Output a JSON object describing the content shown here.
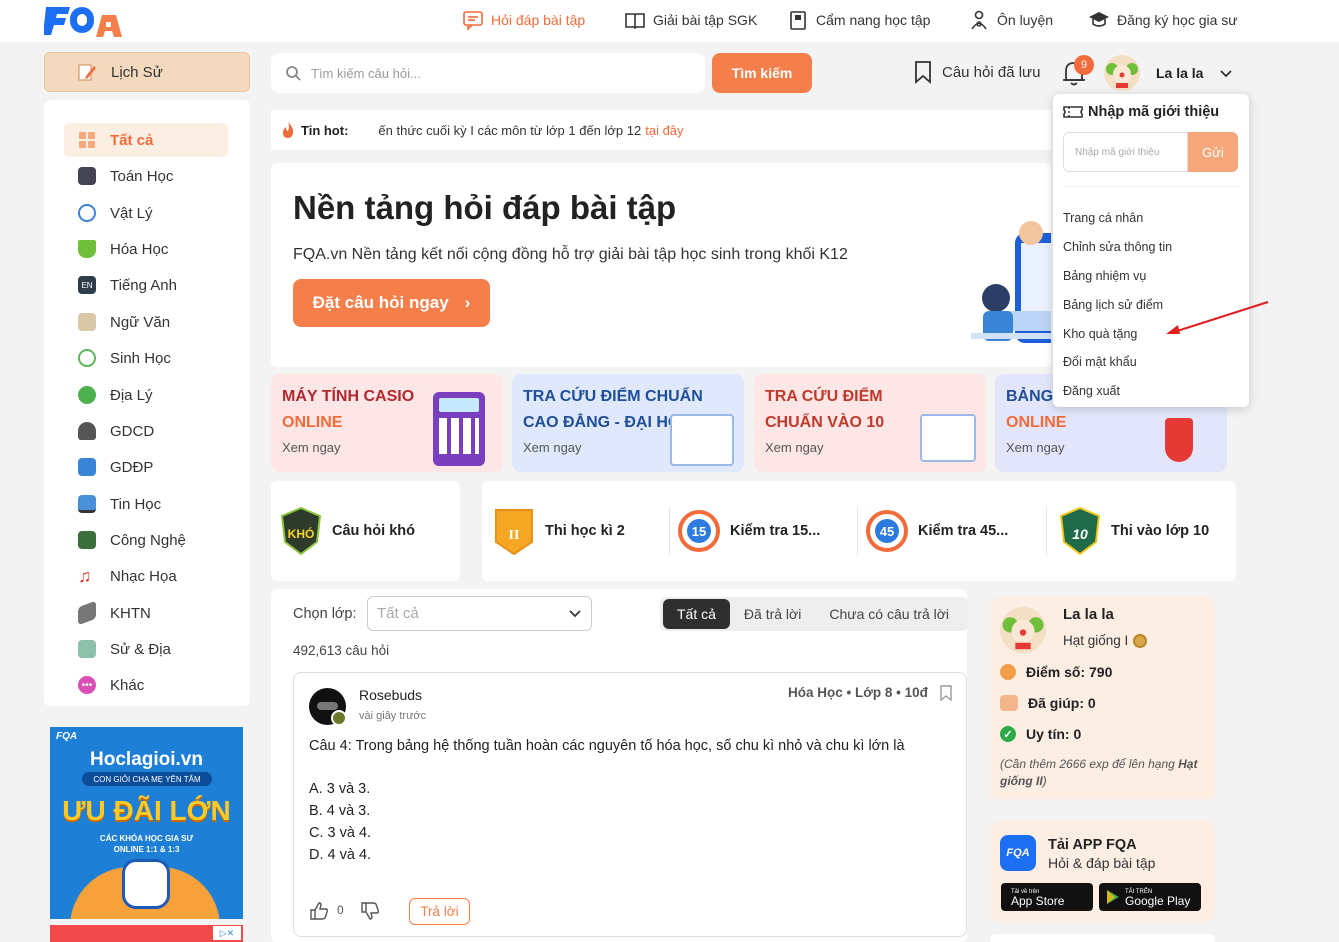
{
  "nav": {
    "items": [
      {
        "label": "Hỏi đáp bài tập",
        "icon": "chat-icon"
      },
      {
        "label": "Giải bài tập SGK",
        "icon": "book-icon"
      },
      {
        "label": "Cẩm nang học tập",
        "icon": "handbook-icon"
      },
      {
        "label": "Ôn luyện",
        "icon": "practice-icon"
      },
      {
        "label": "Đăng ký học gia sư",
        "icon": "graduation-cap-icon"
      }
    ],
    "accent": "#f26b3a"
  },
  "subject_selector": {
    "label": "Lịch Sử"
  },
  "search": {
    "placeholder": "Tìm kiếm câu hỏi...",
    "button": "Tìm kiếm"
  },
  "header": {
    "saved_label": "Câu hỏi đã lưu",
    "notification_count": "9",
    "username": "La la la"
  },
  "sidebar": {
    "items": [
      {
        "label": "Tất cả",
        "icon": "grid-icon",
        "selected": true
      },
      {
        "label": "Toán Học",
        "icon": "calculator-icon"
      },
      {
        "label": "Vật Lý",
        "icon": "atom-icon"
      },
      {
        "label": "Hóa Học",
        "icon": "flask-icon"
      },
      {
        "label": "Tiếng Anh",
        "icon": "english-icon"
      },
      {
        "label": "Ngữ Văn",
        "icon": "open-book-icon"
      },
      {
        "label": "Sinh Học",
        "icon": "dna-icon"
      },
      {
        "label": "Địa Lý",
        "icon": "globe-icon"
      },
      {
        "label": "GDCD",
        "icon": "citizen-icon"
      },
      {
        "label": "GDĐP",
        "icon": "local-icon"
      },
      {
        "label": "Tin Học",
        "icon": "computer-icon"
      },
      {
        "label": "Công Nghệ",
        "icon": "chip-icon"
      },
      {
        "label": "Nhạc Họa",
        "icon": "music-icon"
      },
      {
        "label": "KHTN",
        "icon": "telescope-icon"
      },
      {
        "label": "Sử & Địa",
        "icon": "map-icon"
      },
      {
        "label": "Khác",
        "icon": "more-icon"
      }
    ]
  },
  "ad": {
    "site": "Hoclagioi.vn",
    "tagline": "CON GIỎI CHA MẸ YÊN TÂM",
    "headline": "ƯU ĐÃI LỚN",
    "sub": "CÁC KHÓA HỌC GIA SƯ ONLINE 1:1 & 1:3"
  },
  "hot": {
    "label": "Tin hot:",
    "text": "ến thức cuối kỳ I các môn từ lớp 1 đến lớp 12",
    "link": "tại đây"
  },
  "hero": {
    "title": "Nền tảng hỏi đáp bài tập",
    "subtitle": "FQA.vn Nền tảng kết nối cộng đồng hỗ trợ giải bài tập học sinh trong khối K12",
    "button": "Đặt câu hỏi ngay"
  },
  "cards": [
    {
      "line1": "MÁY TÍNH CASIO",
      "line2": "ONLINE",
      "more": "Xem ngay"
    },
    {
      "line1": "TRA CỨU ĐIỂM CHUẨN",
      "line2": "CAO ĐẲNG - ĐẠI HỌC",
      "more": "Xem ngay"
    },
    {
      "line1": "TRA CỨU ĐIỂM",
      "line2": "CHUẨN VÀO 10",
      "more": "Xem ngay"
    },
    {
      "line1": "BẢNG",
      "line2": "ONLINE",
      "more": "Xem ngay"
    }
  ],
  "exams": [
    {
      "label": "Câu hỏi khó",
      "badge": "KHÓ"
    },
    {
      "label": "Thi học kì 2",
      "badge": "II"
    },
    {
      "label": "Kiểm tra 15...",
      "badge": "15"
    },
    {
      "label": "Kiểm tra 45...",
      "badge": "45"
    },
    {
      "label": "Thi vào lớp 10",
      "badge": "10"
    }
  ],
  "feed": {
    "filter_label": "Chọn lớp:",
    "filter_value": "Tất cả",
    "tabs": [
      "Tất cả",
      "Đã trả lời",
      "Chưa có câu trả lời"
    ],
    "count": "492,613 câu hỏi"
  },
  "question": {
    "author": "Rosebuds",
    "time": "vài giây trước",
    "meta": "Hóa Học • Lớp 8 • 10đ",
    "text": "Câu 4: Trong bảng hệ thống tuần hoàn các nguyên tố hóa học, số chu kì nhỏ và chu kì lớn là",
    "options": [
      "A. 3 và 3.",
      "B. 4 và 3.",
      "C. 3 và 4.",
      "D. 4 và 4."
    ],
    "likes": "0",
    "reply": "Trả lời"
  },
  "profile": {
    "name": "La la la",
    "rank": "Hạt giống I",
    "score": "Điểm số: 790",
    "helped": "Đã giúp: 0",
    "trust": "Uy tín: 0",
    "note_prefix": "(Cần thêm 2666 exp để lên hạng ",
    "note_rank": "Hạt giống II",
    "note_suffix": ")"
  },
  "app": {
    "title": "Tải APP FQA",
    "subtitle": "Hỏi & đáp bài tập",
    "appstore_small": "Tải về trên",
    "appstore": "App Store",
    "googleplay_small": "TẢI TRÊN",
    "googleplay": "Google Play"
  },
  "dropdown": {
    "header": "Nhập mã giới thiệu",
    "input_placeholder": "Nhập mã giới thiệu",
    "send": "Gửi",
    "items": [
      "Trang cá nhân",
      "Chỉnh sửa thông tin",
      "Bảng nhiệm vụ",
      "Bảng lịch sử điểm",
      "Kho quà tặng",
      "Đổi mật khẩu",
      "Đăng xuất"
    ]
  }
}
